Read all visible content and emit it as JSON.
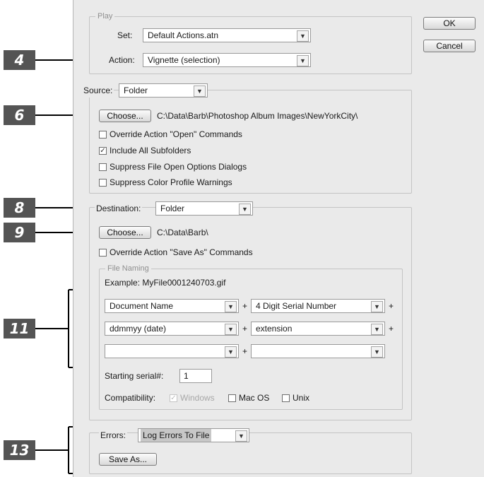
{
  "play": {
    "legend": "Play",
    "set_label": "Set:",
    "set_value": "Default Actions.atn",
    "action_label": "Action:",
    "action_value": "Vignette (selection)"
  },
  "buttons": {
    "ok": "OK",
    "cancel": "Cancel"
  },
  "source": {
    "label": "Source:",
    "value": "Folder",
    "choose_label": "Choose...",
    "path": "C:\\Data\\Barb\\Photoshop Album Images\\NewYorkCity\\",
    "checkboxes": [
      {
        "label": "Override Action \"Open\" Commands",
        "checked": false
      },
      {
        "label": "Include All Subfolders",
        "checked": true
      },
      {
        "label": "Suppress File Open Options Dialogs",
        "checked": false
      },
      {
        "label": "Suppress Color Profile Warnings",
        "checked": false
      }
    ]
  },
  "destination": {
    "label": "Destination:",
    "value": "Folder",
    "choose_label": "Choose...",
    "path": "C:\\Data\\Barb\\",
    "override_label": "Override Action \"Save As\" Commands",
    "file_naming": {
      "legend": "File Naming",
      "example": "Example: MyFile0001240703.gif",
      "rows": [
        {
          "left": "Document Name",
          "right": "4 Digit Serial Number"
        },
        {
          "left": "ddmmyy (date)",
          "right": "extension"
        },
        {
          "left": "",
          "right": ""
        }
      ],
      "plus": "+",
      "serial_label": "Starting serial#:",
      "serial_value": "1",
      "compat_label": "Compatibility:",
      "compat": [
        {
          "label": "Windows",
          "checked": true,
          "disabled": true
        },
        {
          "label": "Mac OS",
          "checked": false,
          "disabled": false
        },
        {
          "label": "Unix",
          "checked": false,
          "disabled": false
        }
      ]
    }
  },
  "errors": {
    "label": "Errors:",
    "value": "Log Errors To File",
    "save_as_label": "Save As..."
  },
  "callouts": [
    "4",
    "6",
    "8",
    "9",
    "11",
    "13"
  ],
  "colors": {
    "dialog_bg": "#eaeaea",
    "callout_bg": "#545454",
    "selection": "#c7c7c7"
  },
  "icons": {
    "dropdown": "chevron-down-icon",
    "check": "checkmark-icon"
  }
}
